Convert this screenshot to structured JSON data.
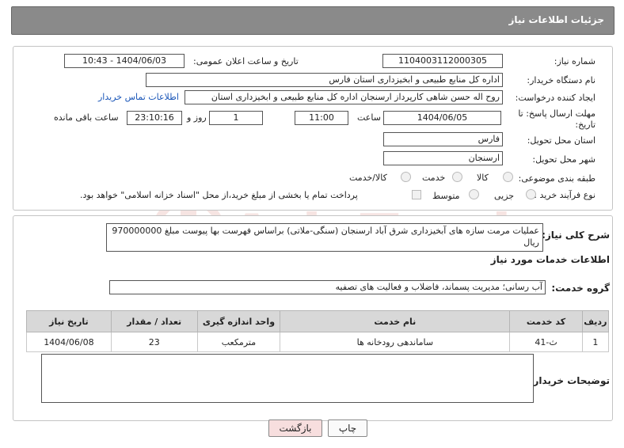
{
  "header": {
    "title": "جزئیات اطلاعات نیاز"
  },
  "fields": {
    "need_number_label": "شماره نیاز:",
    "need_number": "1104003112000305",
    "announce_label": "تاریخ و ساعت اعلان عمومی:",
    "announce_value": "1404/06/03 - 10:43",
    "buyer_org_label": "نام دستگاه خریدار:",
    "buyer_org": "اداره کل منابع طبیعی و ابخیزداری استان فارس",
    "creator_label": "ایجاد کننده درخواست:",
    "creator": "روح اله حسن شاهی کارپرداز ارسنجان اداره کل منابع طبیعی و ابخیزداری استان",
    "contact_link": "اطلاعات تماس خریدار",
    "deadline_label": "مهلت ارسال پاسخ: تا تاریخ:",
    "deadline_date": "1404/06/05",
    "time_label": "ساعت",
    "deadline_time": "11:00",
    "days_value": "1",
    "days_label": "روز و",
    "remaining_time": "23:10:16",
    "remaining_label": "ساعت باقی مانده",
    "province_label": "استان محل تحویل:",
    "province": "فارس",
    "city_label": "شهر محل تحویل:",
    "city": "ارسنجان",
    "category_label": "طبقه بندی موضوعی:",
    "category_options": [
      "کالا",
      "خدمت",
      "کالا/خدمت"
    ],
    "process_label": "نوع فرآیند خرید :",
    "process_options": [
      "جزیی",
      "متوسط"
    ],
    "payment_note": "پرداخت تمام یا بخشی از مبلغ خرید،از محل \"اسناد خزانه اسلامی\" خواهد بود."
  },
  "description": {
    "label": "شرح کلی نیاز:",
    "text": "عملیات مرمت سازه های آبخیزداری شرق آباد ارسنجان (سنگی-ملاتی) براساس فهرست بها پیوست مبلغ 970000000 ریال"
  },
  "services": {
    "section_title": "اطلاعات خدمات مورد نیاز",
    "group_label": "گروه خدمت:",
    "group_value": "آب رسانی؛ مدیریت پسماند، فاضلاب و فعالیت های تصفیه",
    "columns": [
      "ردیف",
      "کد خدمت",
      "نام خدمت",
      "واحد اندازه گیری",
      "تعداد / مقدار",
      "تاریخ نیاز"
    ],
    "rows": [
      [
        "1",
        "ث-41",
        "ساماندهی رودخانه ها",
        "مترمکعب",
        "23",
        "1404/06/08"
      ]
    ]
  },
  "buyer_notes": {
    "label": "توضیحات خریدار:",
    "value": ""
  },
  "buttons": {
    "print": "چاپ",
    "back": "بازگشت"
  },
  "watermark": {
    "text": "AriaTender.neT"
  },
  "colors": {
    "header_bg": "#8a8a8a",
    "link": "#1a56b8",
    "back_button_bg": "#f7dede",
    "watermark": "#c0392b"
  }
}
